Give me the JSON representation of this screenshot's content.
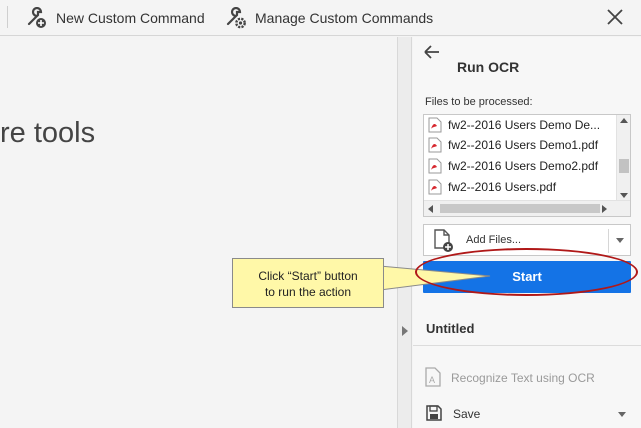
{
  "toolbar": {
    "new_custom_command": "New Custom Command",
    "manage_custom_commands": "Manage Custom Commands",
    "icons": [
      "wrench-plus-icon",
      "wrench-gear-icon",
      "close-icon"
    ]
  },
  "main": {
    "partial_text": "re tools"
  },
  "panel": {
    "title": "Run OCR",
    "files_label": "Files to be processed:",
    "files": [
      "fw2--2016 Users Demo De...",
      "fw2--2016 Users Demo1.pdf",
      "fw2--2016 Users Demo2.pdf",
      "fw2--2016 Users.pdf"
    ],
    "add_files_label": "Add Files...",
    "start_label": "Start",
    "untitled_label": "Untitled",
    "actions": [
      {
        "label": "Recognize Text using OCR",
        "enabled": false
      },
      {
        "label": "Save",
        "enabled": true
      }
    ]
  },
  "callout": {
    "line1": "Click “Start” button",
    "line2": "to run the action"
  },
  "colors": {
    "start_button": "#1473e6",
    "callout_bg": "#fff8a8",
    "ellipse": "#b01818",
    "pdf_red": "#d7282f"
  }
}
